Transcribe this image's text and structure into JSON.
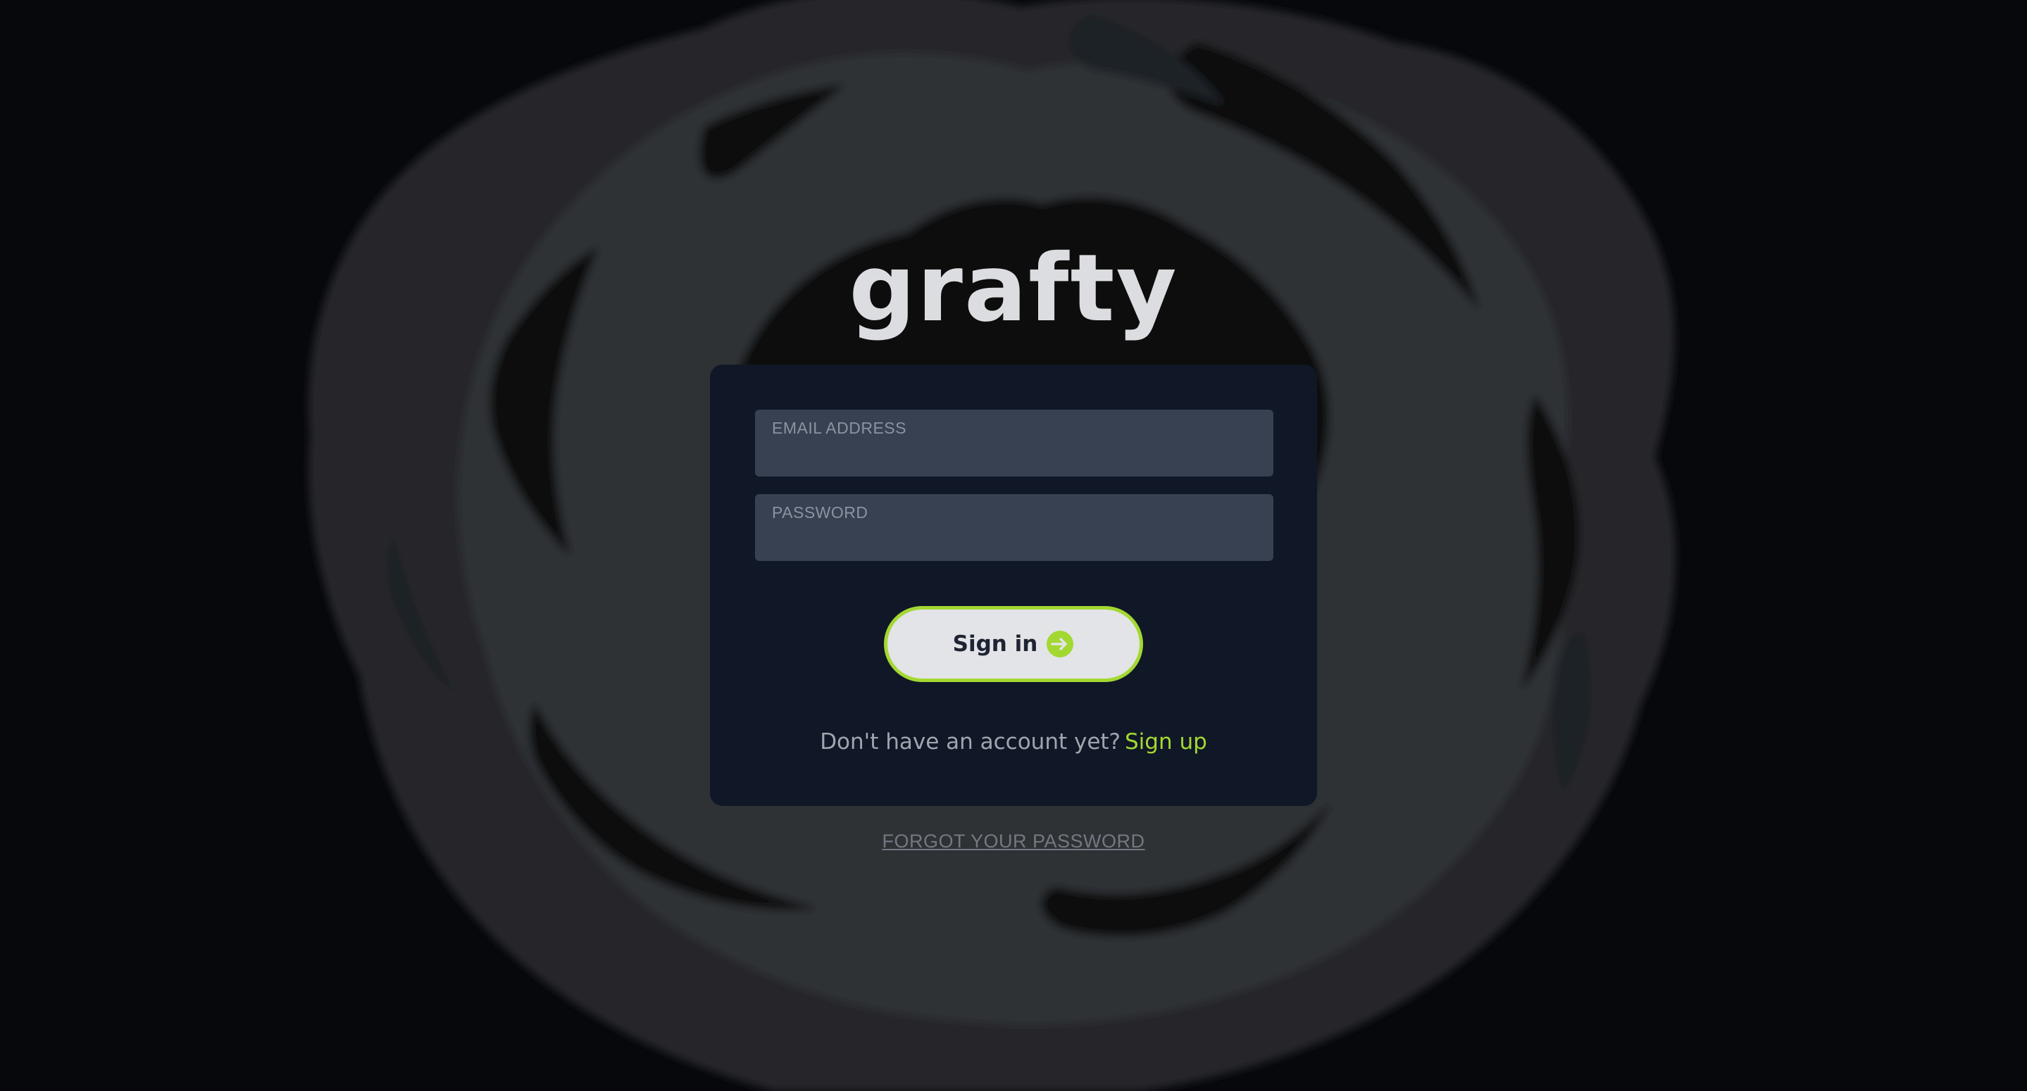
{
  "brand": {
    "logo_text": "grafty"
  },
  "form": {
    "email": {
      "label": "EMAIL ADDRESS",
      "value": ""
    },
    "password": {
      "label": "PASSWORD",
      "value": ""
    },
    "submit_label": "Sign in",
    "submit_icon": "arrow-right-circle-icon",
    "signup_prompt": "Don't have an account yet?",
    "signup_link": "Sign up",
    "forgot_link": "FORGOT YOUR PASSWORD"
  },
  "colors": {
    "accent": "#a3d832",
    "background": "#06080c",
    "smoke": "#2a2c31",
    "card": "#101727",
    "field": "#374151"
  }
}
